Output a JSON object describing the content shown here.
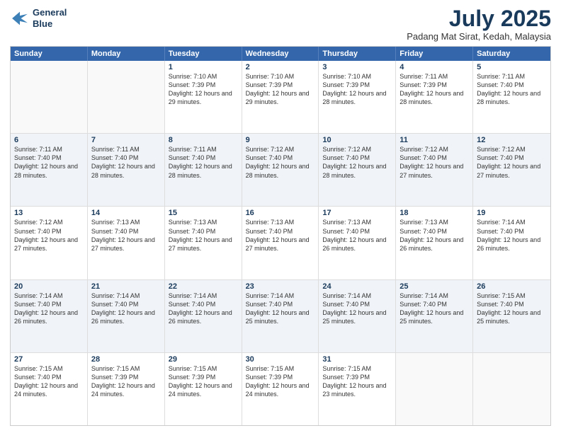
{
  "header": {
    "logo_line1": "General",
    "logo_line2": "Blue",
    "month_title": "July 2025",
    "location": "Padang Mat Sirat, Kedah, Malaysia"
  },
  "weekdays": [
    "Sunday",
    "Monday",
    "Tuesday",
    "Wednesday",
    "Thursday",
    "Friday",
    "Saturday"
  ],
  "rows": [
    [
      {
        "day": "",
        "info": ""
      },
      {
        "day": "",
        "info": ""
      },
      {
        "day": "1",
        "info": "Sunrise: 7:10 AM\nSunset: 7:39 PM\nDaylight: 12 hours and 29 minutes."
      },
      {
        "day": "2",
        "info": "Sunrise: 7:10 AM\nSunset: 7:39 PM\nDaylight: 12 hours and 29 minutes."
      },
      {
        "day": "3",
        "info": "Sunrise: 7:10 AM\nSunset: 7:39 PM\nDaylight: 12 hours and 28 minutes."
      },
      {
        "day": "4",
        "info": "Sunrise: 7:11 AM\nSunset: 7:39 PM\nDaylight: 12 hours and 28 minutes."
      },
      {
        "day": "5",
        "info": "Sunrise: 7:11 AM\nSunset: 7:40 PM\nDaylight: 12 hours and 28 minutes."
      }
    ],
    [
      {
        "day": "6",
        "info": "Sunrise: 7:11 AM\nSunset: 7:40 PM\nDaylight: 12 hours and 28 minutes."
      },
      {
        "day": "7",
        "info": "Sunrise: 7:11 AM\nSunset: 7:40 PM\nDaylight: 12 hours and 28 minutes."
      },
      {
        "day": "8",
        "info": "Sunrise: 7:11 AM\nSunset: 7:40 PM\nDaylight: 12 hours and 28 minutes."
      },
      {
        "day": "9",
        "info": "Sunrise: 7:12 AM\nSunset: 7:40 PM\nDaylight: 12 hours and 28 minutes."
      },
      {
        "day": "10",
        "info": "Sunrise: 7:12 AM\nSunset: 7:40 PM\nDaylight: 12 hours and 28 minutes."
      },
      {
        "day": "11",
        "info": "Sunrise: 7:12 AM\nSunset: 7:40 PM\nDaylight: 12 hours and 27 minutes."
      },
      {
        "day": "12",
        "info": "Sunrise: 7:12 AM\nSunset: 7:40 PM\nDaylight: 12 hours and 27 minutes."
      }
    ],
    [
      {
        "day": "13",
        "info": "Sunrise: 7:12 AM\nSunset: 7:40 PM\nDaylight: 12 hours and 27 minutes."
      },
      {
        "day": "14",
        "info": "Sunrise: 7:13 AM\nSunset: 7:40 PM\nDaylight: 12 hours and 27 minutes."
      },
      {
        "day": "15",
        "info": "Sunrise: 7:13 AM\nSunset: 7:40 PM\nDaylight: 12 hours and 27 minutes."
      },
      {
        "day": "16",
        "info": "Sunrise: 7:13 AM\nSunset: 7:40 PM\nDaylight: 12 hours and 27 minutes."
      },
      {
        "day": "17",
        "info": "Sunrise: 7:13 AM\nSunset: 7:40 PM\nDaylight: 12 hours and 26 minutes."
      },
      {
        "day": "18",
        "info": "Sunrise: 7:13 AM\nSunset: 7:40 PM\nDaylight: 12 hours and 26 minutes."
      },
      {
        "day": "19",
        "info": "Sunrise: 7:14 AM\nSunset: 7:40 PM\nDaylight: 12 hours and 26 minutes."
      }
    ],
    [
      {
        "day": "20",
        "info": "Sunrise: 7:14 AM\nSunset: 7:40 PM\nDaylight: 12 hours and 26 minutes."
      },
      {
        "day": "21",
        "info": "Sunrise: 7:14 AM\nSunset: 7:40 PM\nDaylight: 12 hours and 26 minutes."
      },
      {
        "day": "22",
        "info": "Sunrise: 7:14 AM\nSunset: 7:40 PM\nDaylight: 12 hours and 26 minutes."
      },
      {
        "day": "23",
        "info": "Sunrise: 7:14 AM\nSunset: 7:40 PM\nDaylight: 12 hours and 25 minutes."
      },
      {
        "day": "24",
        "info": "Sunrise: 7:14 AM\nSunset: 7:40 PM\nDaylight: 12 hours and 25 minutes."
      },
      {
        "day": "25",
        "info": "Sunrise: 7:14 AM\nSunset: 7:40 PM\nDaylight: 12 hours and 25 minutes."
      },
      {
        "day": "26",
        "info": "Sunrise: 7:15 AM\nSunset: 7:40 PM\nDaylight: 12 hours and 25 minutes."
      }
    ],
    [
      {
        "day": "27",
        "info": "Sunrise: 7:15 AM\nSunset: 7:40 PM\nDaylight: 12 hours and 24 minutes."
      },
      {
        "day": "28",
        "info": "Sunrise: 7:15 AM\nSunset: 7:39 PM\nDaylight: 12 hours and 24 minutes."
      },
      {
        "day": "29",
        "info": "Sunrise: 7:15 AM\nSunset: 7:39 PM\nDaylight: 12 hours and 24 minutes."
      },
      {
        "day": "30",
        "info": "Sunrise: 7:15 AM\nSunset: 7:39 PM\nDaylight: 12 hours and 24 minutes."
      },
      {
        "day": "31",
        "info": "Sunrise: 7:15 AM\nSunset: 7:39 PM\nDaylight: 12 hours and 23 minutes."
      },
      {
        "day": "",
        "info": ""
      },
      {
        "day": "",
        "info": ""
      }
    ]
  ]
}
